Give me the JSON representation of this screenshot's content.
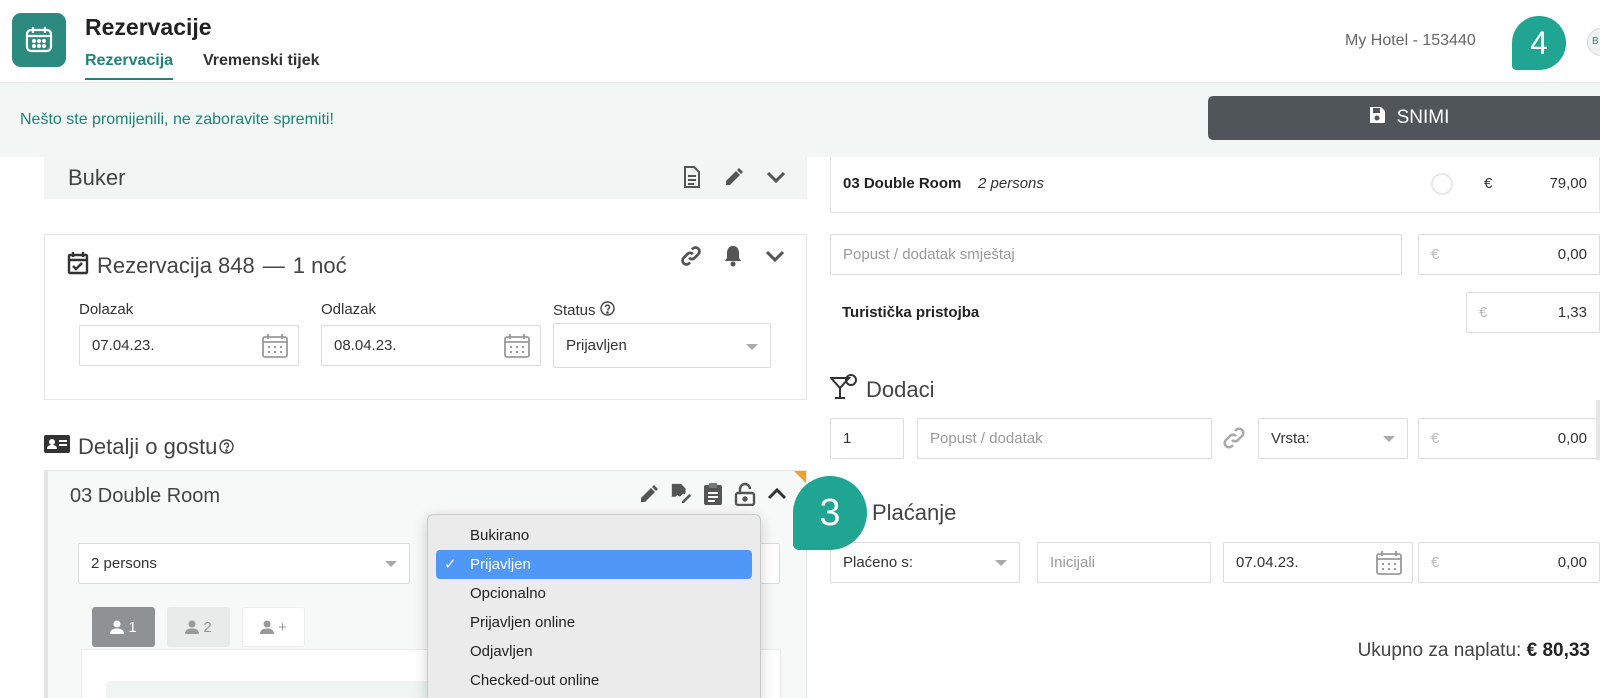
{
  "header": {
    "title": "Rezervacije",
    "tabs": [
      {
        "label": "Rezervacija",
        "active": true
      },
      {
        "label": "Vremenski tijek",
        "active": false
      }
    ],
    "hotel": "My Hotel - 153440",
    "step_badge": "4",
    "avatar_initial": "B"
  },
  "notice": {
    "text": "Nešto ste promijenili, ne zaboravite spremiti!",
    "save_label": "SNIMI"
  },
  "buker": {
    "title": "Buker"
  },
  "reservation": {
    "title": "Rezervacija 848",
    "dash": "—",
    "nights": "1 noć",
    "arrival_label": "Dolazak",
    "arrival_value": "07.04.23.",
    "departure_label": "Odlazak",
    "departure_value": "08.04.23.",
    "status_label": "Status",
    "status_value": "Prijavljen"
  },
  "guest_details": {
    "title": "Detalji o gostu",
    "room_title": "03 Double Room",
    "persons_value": "2 persons",
    "guest_tabs": [
      "1",
      "2",
      "+"
    ]
  },
  "status_dropdown": {
    "options": [
      {
        "label": "Bukirano",
        "selected": false
      },
      {
        "label": "Prijavljen",
        "selected": true
      },
      {
        "label": "Opcionalno",
        "selected": false
      },
      {
        "label": "Prijavljen online",
        "selected": false
      },
      {
        "label": "Odjavljen",
        "selected": false
      },
      {
        "label": "Checked-out online",
        "selected": false
      }
    ],
    "check_mark": "✓"
  },
  "step_badge_3": "3",
  "pricing": {
    "room_name": "03 Double Room",
    "room_persons": "2 persons",
    "room_currency": "€",
    "room_price": "79,00",
    "discount_placeholder": "Popust / dodatak smještaj",
    "discount_currency": "€",
    "discount_value": "0,00",
    "tax_label": "Turistička pristojba",
    "tax_currency": "€",
    "tax_value": "1,33"
  },
  "extras": {
    "title": "Dodaci",
    "qty": "1",
    "desc_placeholder": "Popust / dodatak",
    "type_label": "Vrsta:",
    "currency": "€",
    "value": "0,00"
  },
  "payment": {
    "title": "Plaćanje",
    "method_label": "Plaćeno s:",
    "initials_placeholder": "Inicijali",
    "date": "07.04.23.",
    "currency": "€",
    "value": "0,00"
  },
  "total": {
    "label": "Ukupno za naplatu:",
    "value": "€ 80,33"
  },
  "colors": {
    "brand": "#2d8a7e",
    "badge": "#1fa592",
    "save_button": "#505559",
    "selected_option": "#4f98f7"
  }
}
